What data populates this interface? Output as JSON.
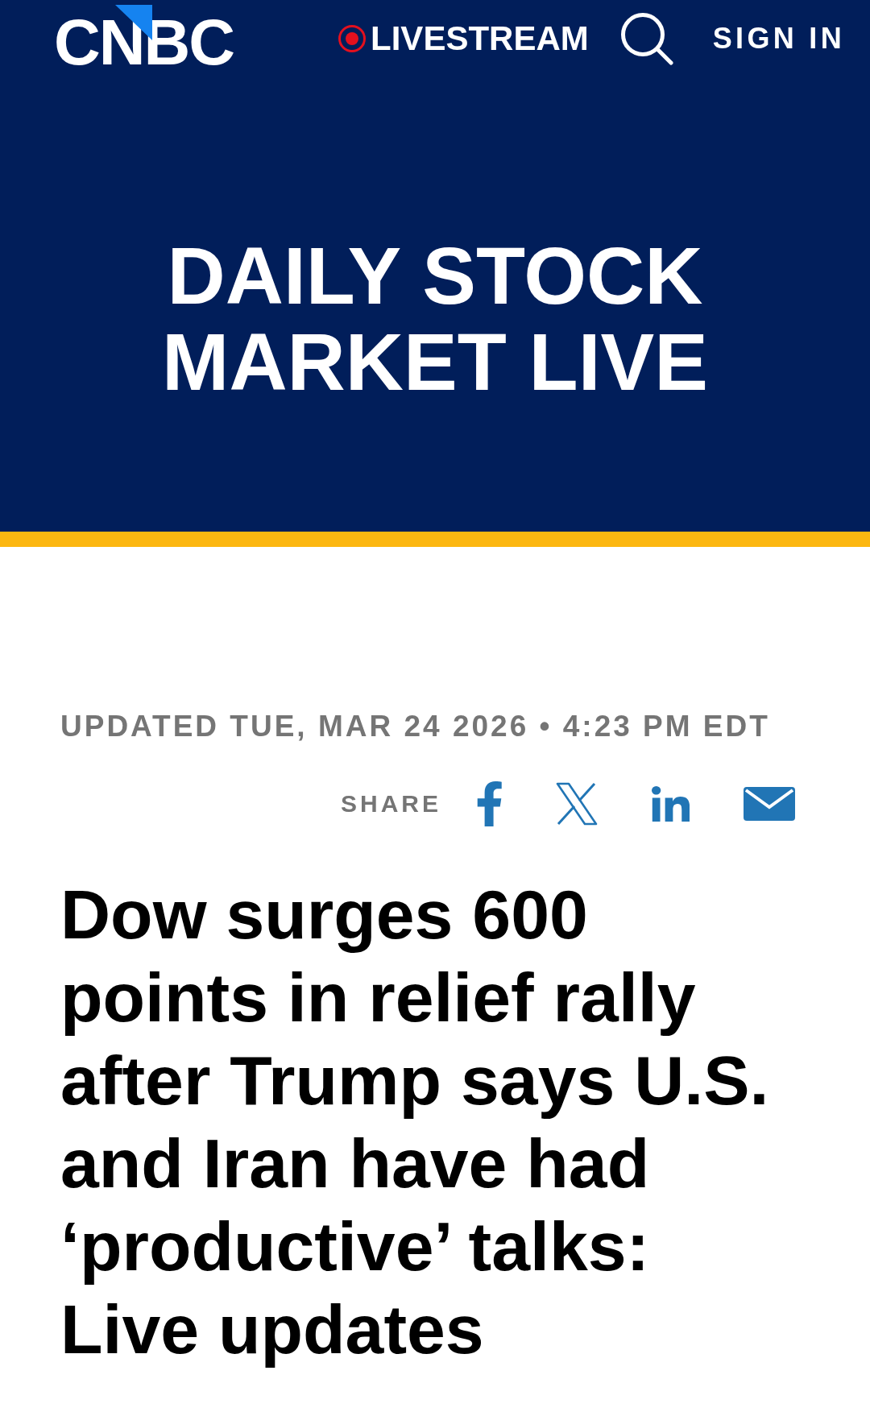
{
  "header": {
    "logo": "CNBC",
    "livestream": "LIVESTREAM",
    "sign_in": "SIGN IN"
  },
  "banner": {
    "title": "DAILY STOCK MARKET LIVE"
  },
  "article": {
    "updated": "UPDATED TUE, MAR 24 2026 • 4:23 PM EDT",
    "share": {
      "label": "SHARE",
      "links": [
        {
          "kind": "facebook"
        },
        {
          "kind": "x"
        },
        {
          "kind": "linkedin"
        },
        {
          "kind": "email"
        }
      ]
    },
    "headline": "Dow surges 600 points in relief rally after Trump says U.S. and Iran have had ‘productive’ talks: Live updates"
  }
}
